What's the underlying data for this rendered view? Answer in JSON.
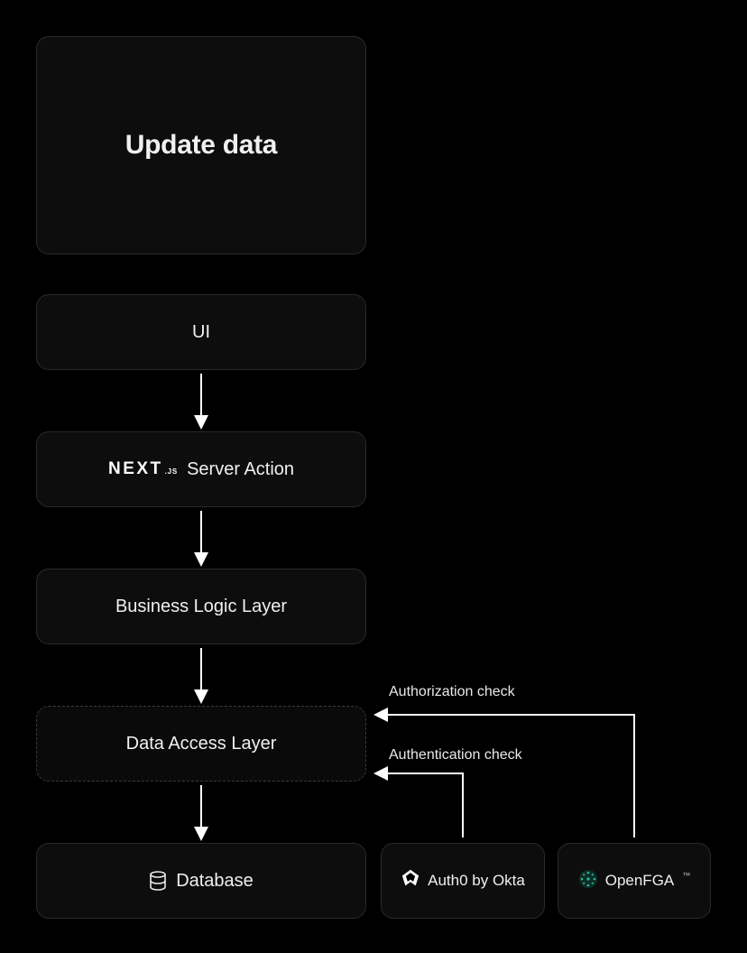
{
  "title_box": {
    "text": "Update data"
  },
  "nodes": {
    "ui": "UI",
    "server_action": "Server Action",
    "business_logic": "Business Logic Layer",
    "data_access": "Data Access Layer",
    "database": "Database",
    "auth0": "Auth0 by Okta",
    "openfga": "OpenFGA"
  },
  "annotations": {
    "authorization": "Authorization check",
    "authentication": "Authentication check"
  },
  "logos": {
    "nextjs_main": "NEXT",
    "nextjs_sub": ".JS",
    "openfga_tm": "™"
  },
  "colors": {
    "bg": "#000000",
    "node_bg": "#0d0d0d",
    "node_border": "#2a2a2a",
    "text": "#e8e8e8",
    "arrow": "#ffffff",
    "openfga_accent": "#2fb897"
  }
}
